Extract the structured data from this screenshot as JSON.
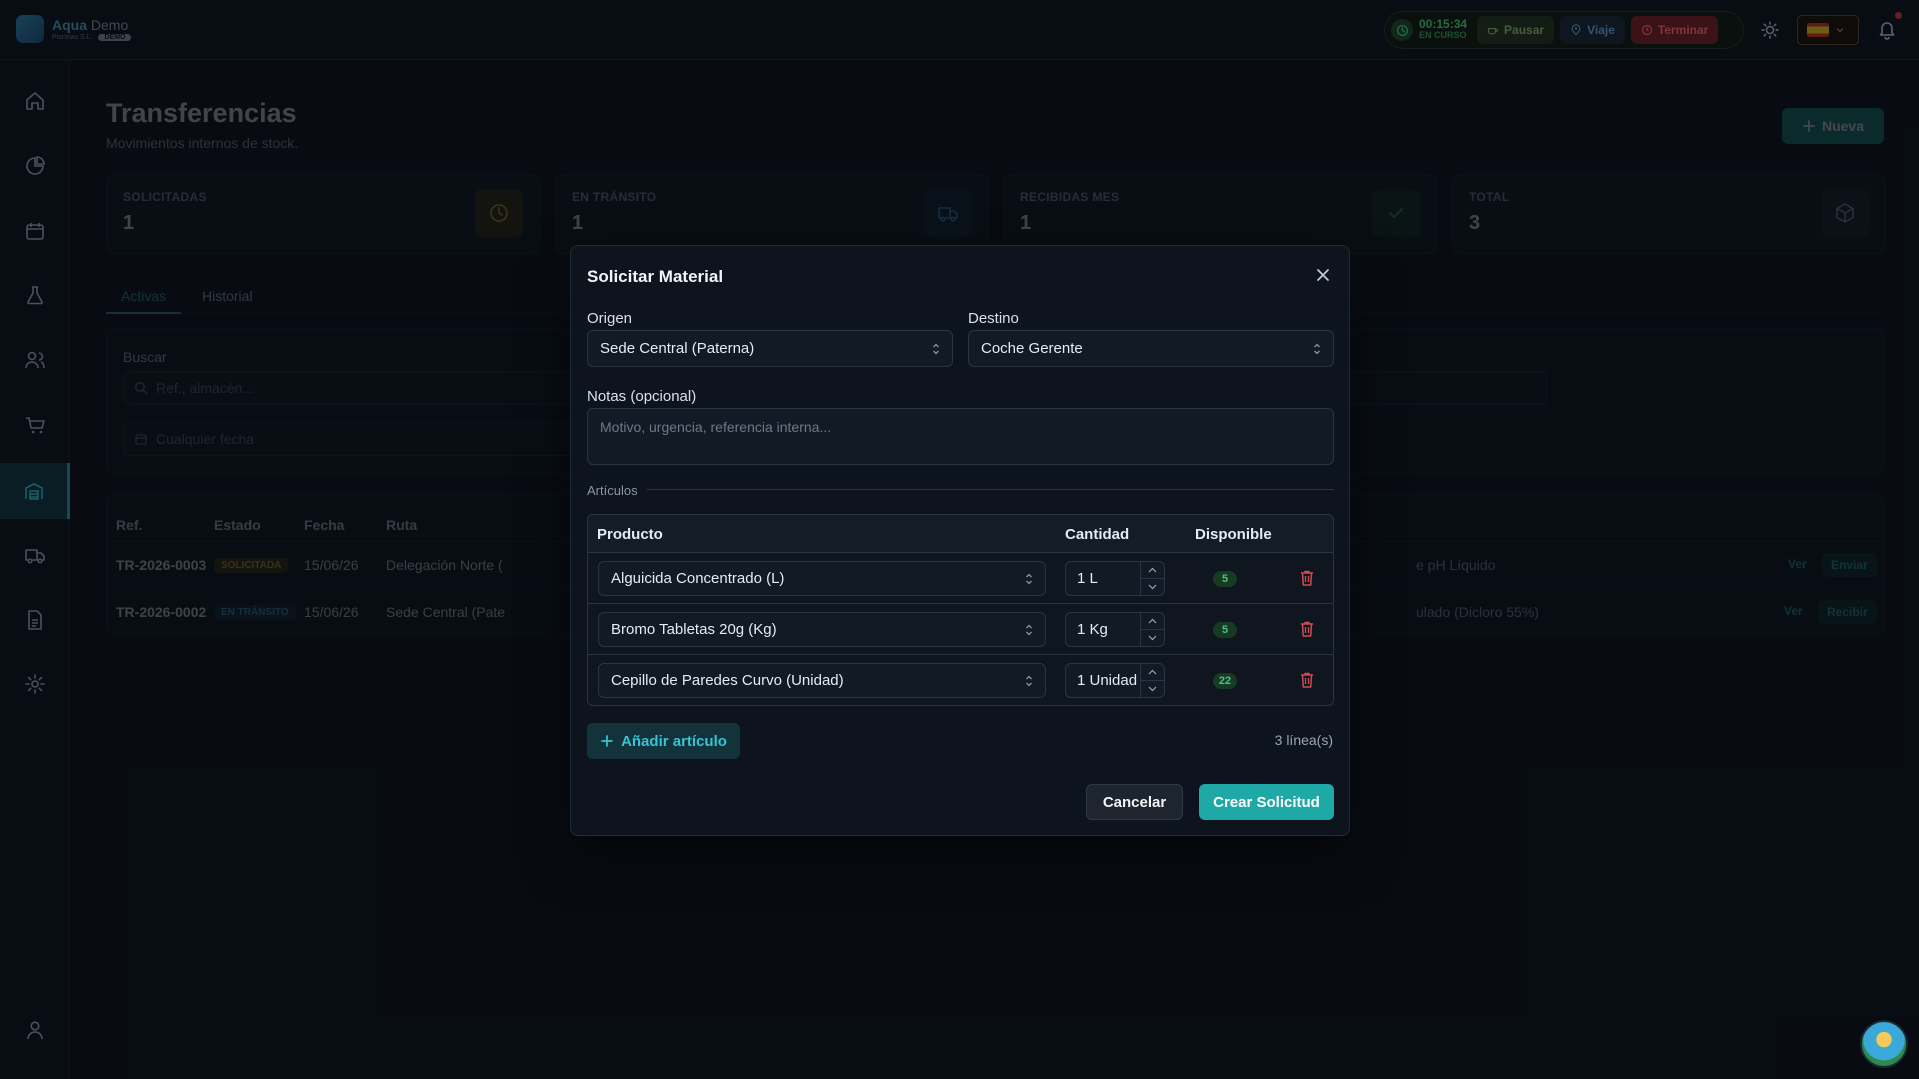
{
  "app": {
    "logo_name_1": "Aqua",
    "logo_name_2": "Demo",
    "logo_sub": "Piscinas S.L.",
    "logo_badge": "DEMO"
  },
  "topbar": {
    "timer": "00:15:34",
    "timer_status": "EN CURSO",
    "pause_label": "Pausar",
    "trip_label": "Viaje",
    "end_label": "Terminar"
  },
  "sidebar": {
    "items": [
      {
        "icon": "home-icon"
      },
      {
        "icon": "chart-pie-icon"
      },
      {
        "icon": "calendar-icon"
      },
      {
        "icon": "flask-icon"
      },
      {
        "icon": "users-icon"
      },
      {
        "icon": "cart-icon"
      },
      {
        "icon": "warehouse-icon",
        "active": true
      },
      {
        "icon": "truck-icon"
      },
      {
        "icon": "document-icon"
      },
      {
        "icon": "settings-icon"
      }
    ],
    "bottom_icon": "user-icon"
  },
  "page": {
    "title": "Transferencias",
    "subtitle": "Movimientos internos de stock.",
    "new_button": "Nueva",
    "stats": [
      {
        "label": "SOLICITADAS",
        "value": "1",
        "icon": "clock-icon",
        "color": "#d9a52a"
      },
      {
        "label": "EN TRÁNSITO",
        "value": "1",
        "icon": "truck-icon",
        "color": "#3e9ad0"
      },
      {
        "label": "RECIBIDAS MES",
        "value": "1",
        "icon": "check-icon",
        "color": "#3aa261"
      },
      {
        "label": "TOTAL",
        "value": "3",
        "icon": "box-icon",
        "color": "#9aa6b4"
      }
    ],
    "tabs": [
      "Activas",
      "Historial"
    ],
    "filters": {
      "search_label": "Buscar",
      "search_placeholder": "Ref., almacén...",
      "date_placeholder": "Cualquier fecha"
    },
    "table": {
      "headers": [
        "Ref.",
        "Estado",
        "Fecha",
        "Ruta"
      ],
      "rows": [
        {
          "ref": "TR-2026-0003",
          "status": "SOLICITADA",
          "date": "15/06/26",
          "route": "Delegación Norte (",
          "tail": "e pH Líquido",
          "action1": "Ver",
          "action2": "Enviar"
        },
        {
          "ref": "TR-2026-0002",
          "status": "EN TRÁNSITO",
          "date": "15/06/26",
          "route": "Sede Central (Pate",
          "tail": "ulado (Dicloro 55%)",
          "action1": "Ver",
          "action2": "Recibir"
        }
      ]
    }
  },
  "modal": {
    "title": "Solicitar Material",
    "origin_label": "Origen",
    "origin_value": "Sede Central (Paterna)",
    "dest_label": "Destino",
    "dest_value": "Coche Gerente",
    "notes_label": "Notas (opcional)",
    "notes_placeholder": "Motivo, urgencia, referencia interna...",
    "section_label": "Artículos",
    "columns": [
      "Producto",
      "Cantidad",
      "Disponible"
    ],
    "items": [
      {
        "product": "Alguicida Concentrado (L)",
        "qty": "1 L",
        "available": "5"
      },
      {
        "product": "Bromo Tabletas 20g (Kg)",
        "qty": "1 Kg",
        "available": "5"
      },
      {
        "product": "Cepillo de Paredes Curvo (Unidad)",
        "qty": "1 Unidad",
        "available": "22"
      }
    ],
    "add_button": "Añadir artículo",
    "lines_count": "3 línea(s)",
    "cancel_button": "Cancelar",
    "create_button": "Crear Solicitud"
  }
}
